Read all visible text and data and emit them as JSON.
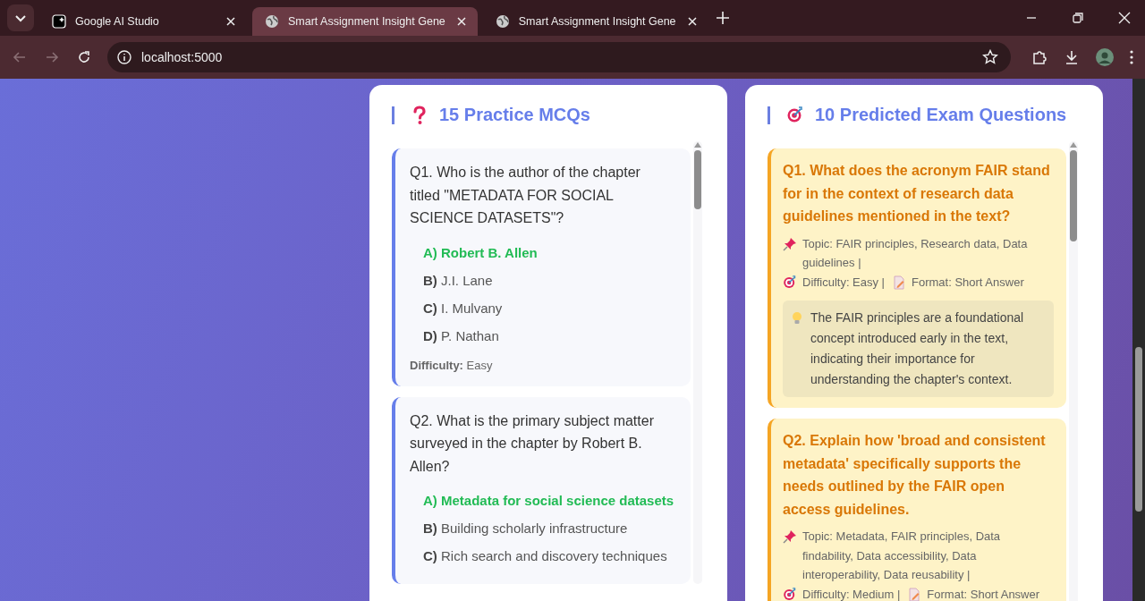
{
  "browser": {
    "tabs": [
      {
        "title": "Google AI Studio",
        "selected": false,
        "kind": "studio"
      },
      {
        "title": "Smart Assignment Insight Gene",
        "selected": true,
        "kind": "globe"
      },
      {
        "title": "Smart Assignment Insight Gene",
        "selected": false,
        "kind": "globe"
      }
    ],
    "address": "localhost:5000"
  },
  "mcq_panel": {
    "title": "15 Practice MCQs",
    "questions": [
      {
        "question": "Q1. Who is the author of the chapter titled \"METADATA FOR SOCIAL SCIENCE DATASETS\"?",
        "options": [
          {
            "text": "**A)** Robert B. Allen",
            "correct": true
          },
          {
            "text": "**B)** J.I. Lane",
            "correct": false
          },
          {
            "text": "**C)** I. Mulvany",
            "correct": false
          },
          {
            "text": "**D)** P. Nathan",
            "correct": false
          }
        ],
        "difficulty": "**Difficulty:** Easy"
      },
      {
        "question": "Q2. What is the primary subject matter surveyed in the chapter by Robert B. Allen?",
        "options": [
          {
            "text": "**A)** Metadata for social science datasets",
            "correct": true
          },
          {
            "text": "**B)** Building scholarly infrastructure",
            "correct": false
          },
          {
            "text": "**C)** Rich search and discovery techniques",
            "correct": false
          }
        ]
      }
    ]
  },
  "exam_panel": {
    "title": "10 Predicted Exam Questions",
    "questions": [
      {
        "question": "Q1. What does the acronym FAIR stand for in the context of research data guidelines mentioned in the text?",
        "topic": "Topic: FAIR principles, Research data, Data guidelines |",
        "difficulty": "Difficulty: Easy |",
        "format": "Format: Short Answer",
        "hint": "The FAIR principles are a foundational concept introduced early in the text, indicating their importance for understanding the chapter's context."
      },
      {
        "question": "Q2. Explain how 'broad and consistent metadata' specifically supports the needs outlined by the FAIR open access guidelines.",
        "topic": "Topic: Metadata, FAIR principles, Data findability, Data accessibility, Data interoperability, Data reusability |",
        "difficulty": "Difficulty: Medium |",
        "format": "Format: Short Answer"
      }
    ]
  }
}
